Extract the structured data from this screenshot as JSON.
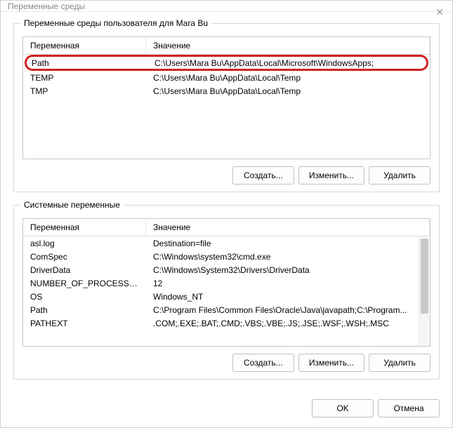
{
  "window": {
    "title": "Переменные среды"
  },
  "user_section": {
    "label": "Переменные среды пользователя для Mara Bu",
    "columns": {
      "variable": "Переменная",
      "value": "Значение"
    },
    "rows": [
      {
        "name": "Path",
        "value": "C:\\Users\\Mara Bu\\AppData\\Local\\Microsoft\\WindowsApps;"
      },
      {
        "name": "TEMP",
        "value": "C:\\Users\\Mara Bu\\AppData\\Local\\Temp"
      },
      {
        "name": "TMP",
        "value": "C:\\Users\\Mara Bu\\AppData\\Local\\Temp"
      }
    ],
    "buttons": {
      "new": "Создать...",
      "edit": "Изменить...",
      "delete": "Удалить"
    }
  },
  "system_section": {
    "label": "Системные переменные",
    "columns": {
      "variable": "Переменная",
      "value": "Значение"
    },
    "rows": [
      {
        "name": "asl.log",
        "value": "Destination=file"
      },
      {
        "name": "ComSpec",
        "value": "C:\\Windows\\system32\\cmd.exe"
      },
      {
        "name": "DriverData",
        "value": "C:\\Windows\\System32\\Drivers\\DriverData"
      },
      {
        "name": "NUMBER_OF_PROCESSORS",
        "value": "12"
      },
      {
        "name": "OS",
        "value": "Windows_NT"
      },
      {
        "name": "Path",
        "value": "C:\\Program Files\\Common Files\\Oracle\\Java\\javapath;C:\\Program..."
      },
      {
        "name": "PATHEXT",
        "value": ".COM;.EXE;.BAT;.CMD;.VBS;.VBE;.JS;.JSE;.WSF;.WSH;.MSC"
      }
    ],
    "buttons": {
      "new": "Создать...",
      "edit": "Изменить...",
      "delete": "Удалить"
    }
  },
  "dialog_buttons": {
    "ok": "OK",
    "cancel": "Отмена"
  }
}
